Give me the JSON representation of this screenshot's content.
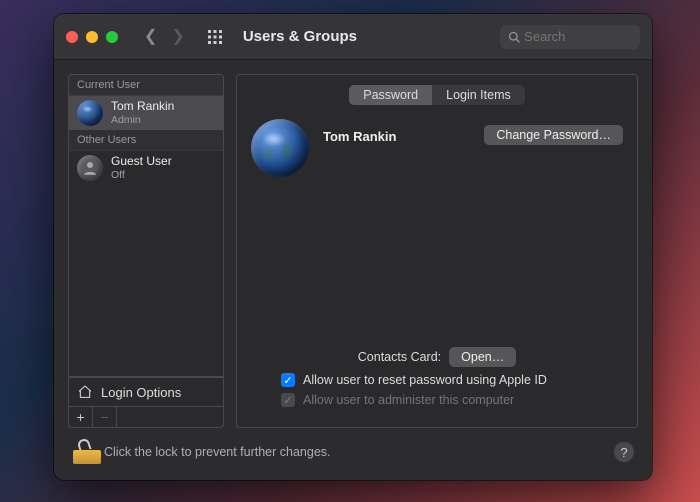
{
  "window": {
    "title": "Users & Groups"
  },
  "search": {
    "placeholder": "Search"
  },
  "sidebar": {
    "current_header": "Current User",
    "other_header": "Other Users",
    "current": {
      "name": "Tom Rankin",
      "role": "Admin"
    },
    "others": [
      {
        "name": "Guest User",
        "status": "Off"
      }
    ],
    "login_options": "Login Options"
  },
  "tabs": {
    "password": "Password",
    "login_items": "Login Items"
  },
  "profile": {
    "name": "Tom Rankin",
    "change_password": "Change Password…",
    "contacts_label": "Contacts Card:",
    "open": "Open…",
    "allow_reset": "Allow user to reset password using Apple ID",
    "allow_admin": "Allow user to administer this computer"
  },
  "footer": {
    "lock_text": "Click the lock to prevent further changes.",
    "help": "?"
  }
}
